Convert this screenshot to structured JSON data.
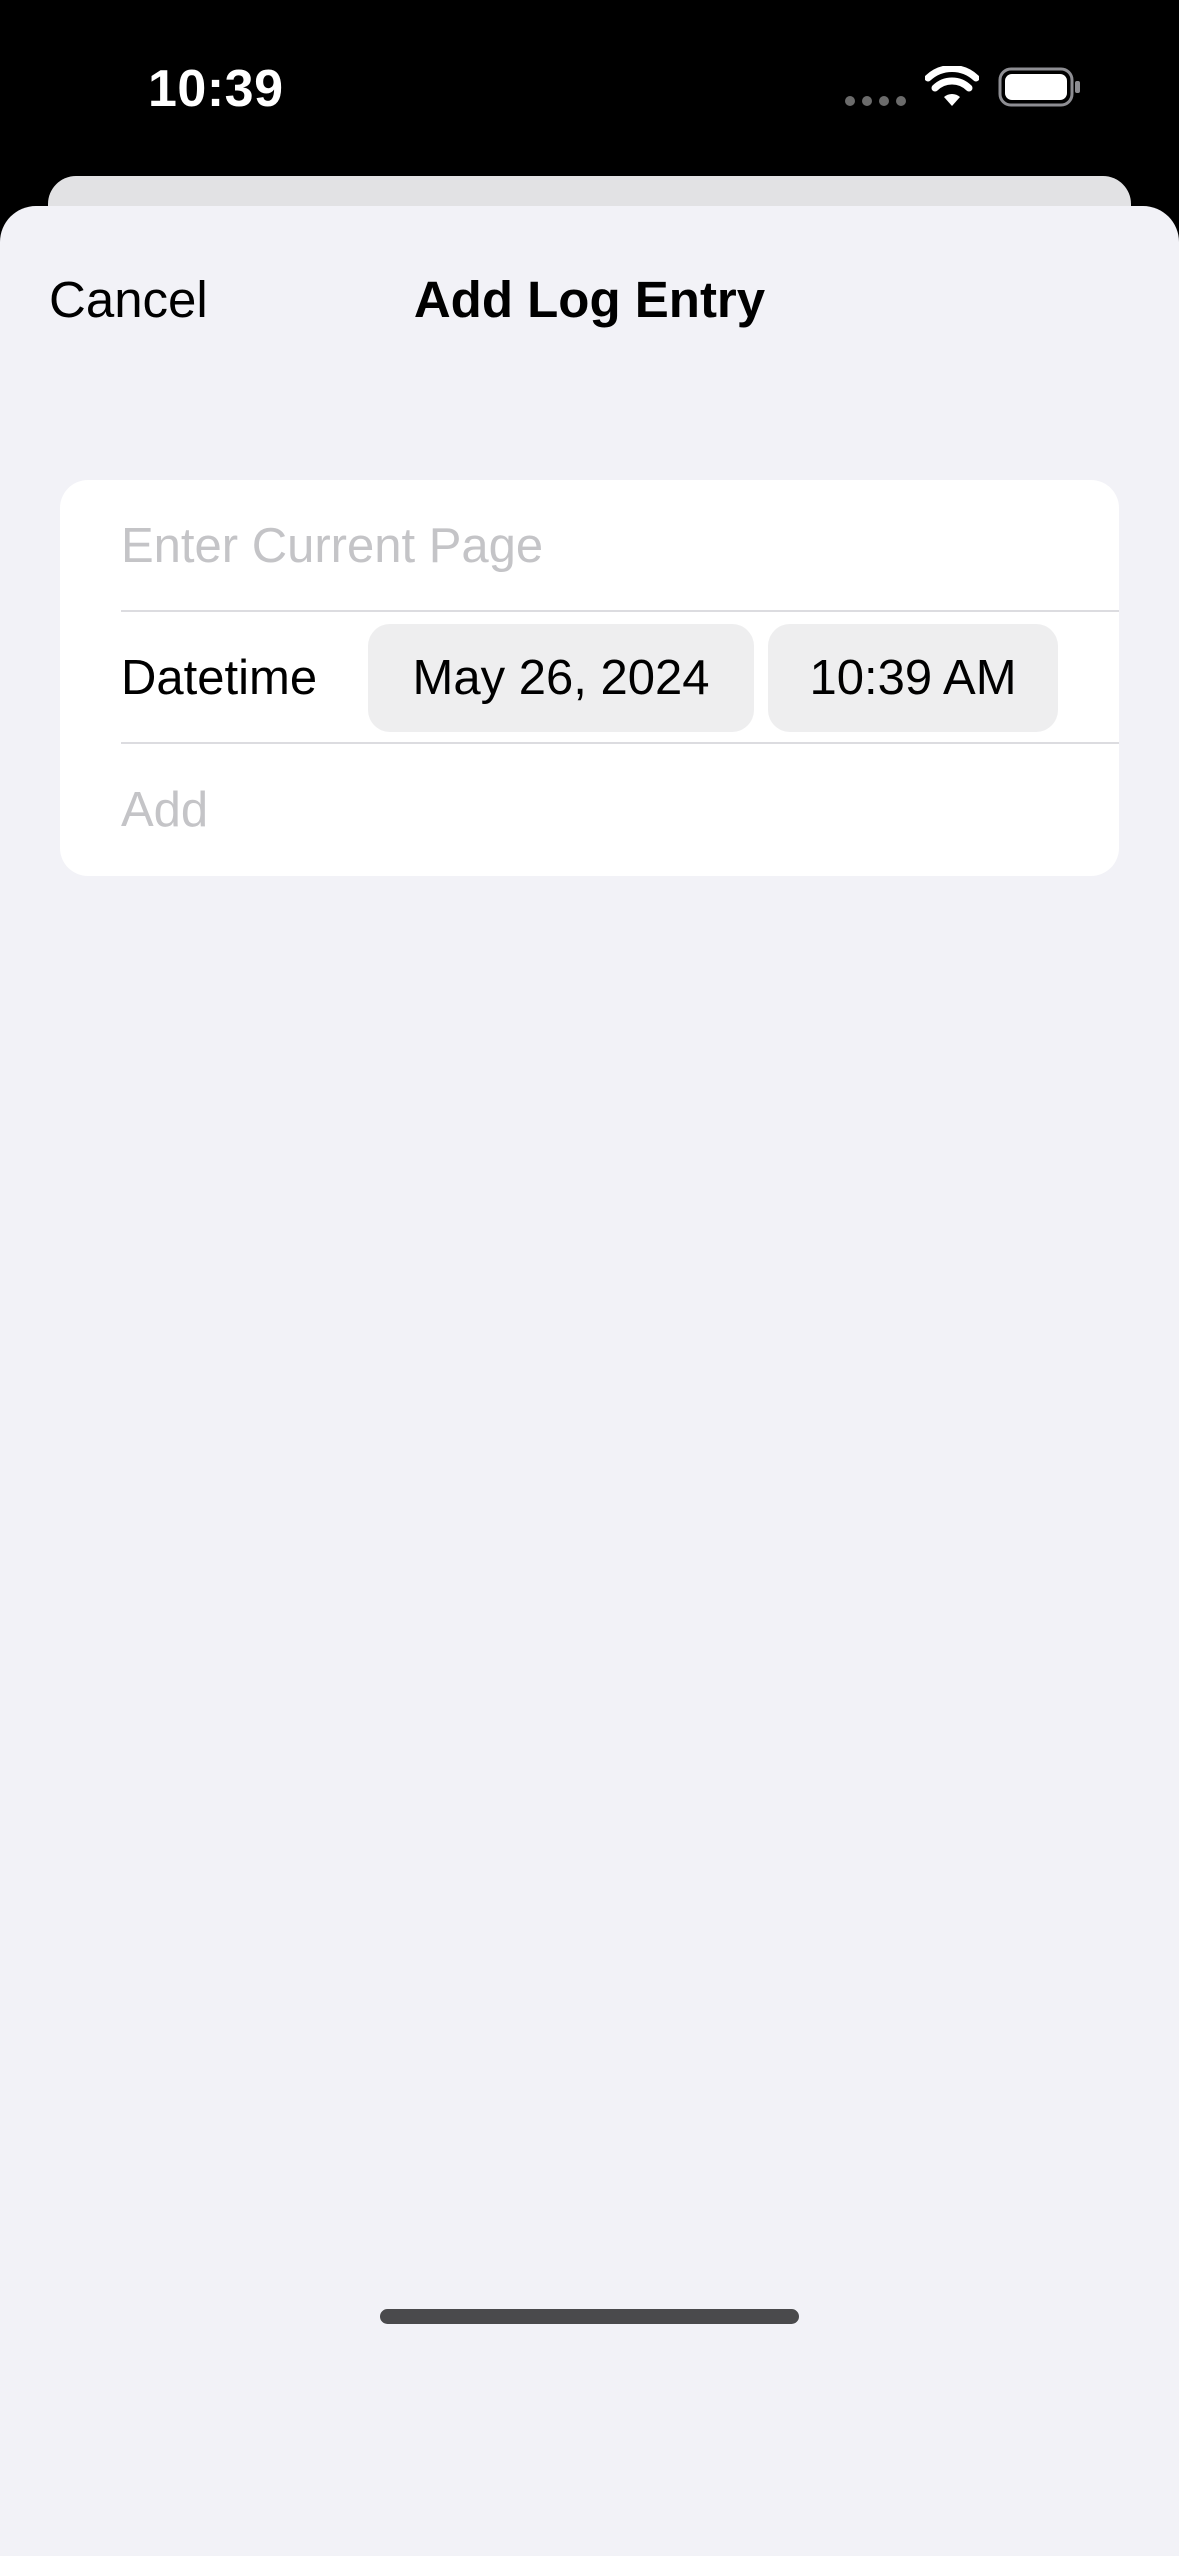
{
  "status_bar": {
    "time": "10:39",
    "icons": [
      "signal-dots-icon",
      "wifi-icon",
      "battery-icon"
    ]
  },
  "nav": {
    "cancel_label": "Cancel",
    "title": "Add Log Entry"
  },
  "form": {
    "page_input": {
      "value": "",
      "placeholder": "Enter Current Page"
    },
    "datetime": {
      "label": "Datetime",
      "date": "May 26, 2024",
      "time": "10:39 AM"
    },
    "add_label": "Add"
  },
  "colors": {
    "sheet_background": "#f2f2f7",
    "card_background": "#ffffff",
    "placeholder": "#c4c4c7",
    "pill_background": "#eeeeef",
    "status_bar_background": "#000000"
  }
}
